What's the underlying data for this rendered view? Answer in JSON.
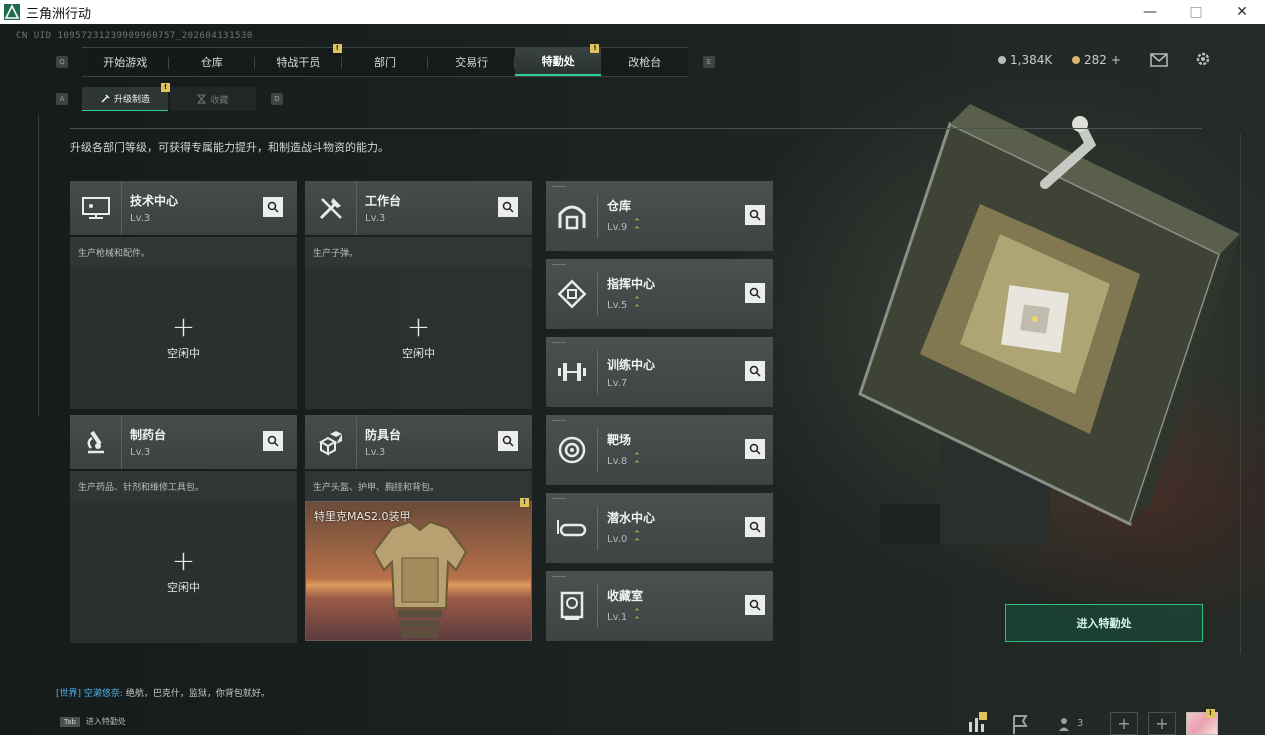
{
  "window": {
    "title": "三角洲行动"
  },
  "uid": "CN UID 10957231239909960757_202604131530",
  "nav": {
    "tabs": [
      {
        "label": "开始游戏",
        "active": false,
        "badge": false
      },
      {
        "label": "仓库",
        "active": false,
        "badge": false
      },
      {
        "label": "特战干员",
        "active": false,
        "badge": true
      },
      {
        "label": "部门",
        "active": false,
        "badge": false
      },
      {
        "label": "交易行",
        "active": false,
        "badge": false
      },
      {
        "label": "特勤处",
        "active": true,
        "badge": true
      },
      {
        "label": "改枪台",
        "active": false,
        "badge": false
      }
    ],
    "key_left": "Q",
    "key_right": "E"
  },
  "subtabs": {
    "key_left": "A",
    "key_right": "D",
    "upgrade": "升级制造",
    "favorites": "收藏"
  },
  "currency": {
    "coins": "1,384K",
    "premium": "282",
    "plus": "+"
  },
  "description": "升级各部门等级，可获得专属能力提升，和制造战斗物资的能力。",
  "cards": [
    {
      "name": "技术中心",
      "level": "Lv.3",
      "desc": "生产枪械和配件。",
      "state": "idle"
    },
    {
      "name": "工作台",
      "level": "Lv.3",
      "desc": "生产子弹。",
      "state": "idle"
    },
    {
      "name": "制药台",
      "level": "Lv.3",
      "desc": "生产药品、针剂和维修工具包。",
      "state": "idle"
    },
    {
      "name": "防具台",
      "level": "Lv.3",
      "desc": "生产头盔、护甲、胸挂和背包。",
      "state": "crafting",
      "item": "特里克MAS2.0装甲"
    }
  ],
  "idle_plus": "+",
  "idle_text": "空闲中",
  "side_items": [
    {
      "name": "仓库",
      "level": "Lv.9",
      "upgradable": true
    },
    {
      "name": "指挥中心",
      "level": "Lv.5",
      "upgradable": true
    },
    {
      "name": "训练中心",
      "level": "Lv.7",
      "upgradable": false
    },
    {
      "name": "靶场",
      "level": "Lv.8",
      "upgradable": true
    },
    {
      "name": "潜水中心",
      "level": "Lv.0",
      "upgradable": true
    },
    {
      "name": "收藏室",
      "level": "Lv.1",
      "upgradable": true
    }
  ],
  "enter_button": "进入特勤处",
  "chat": {
    "channel": "[世界]",
    "user": "空濑悠奈:",
    "message": "绝航，巴克什，监狱，你背包就好。"
  },
  "tab_hint": {
    "key": "Tab",
    "label": "进入特勤处"
  },
  "dock": {
    "friends_count": "3"
  },
  "colors": {
    "accent": "#30d090",
    "badge": "#e2c35a"
  }
}
